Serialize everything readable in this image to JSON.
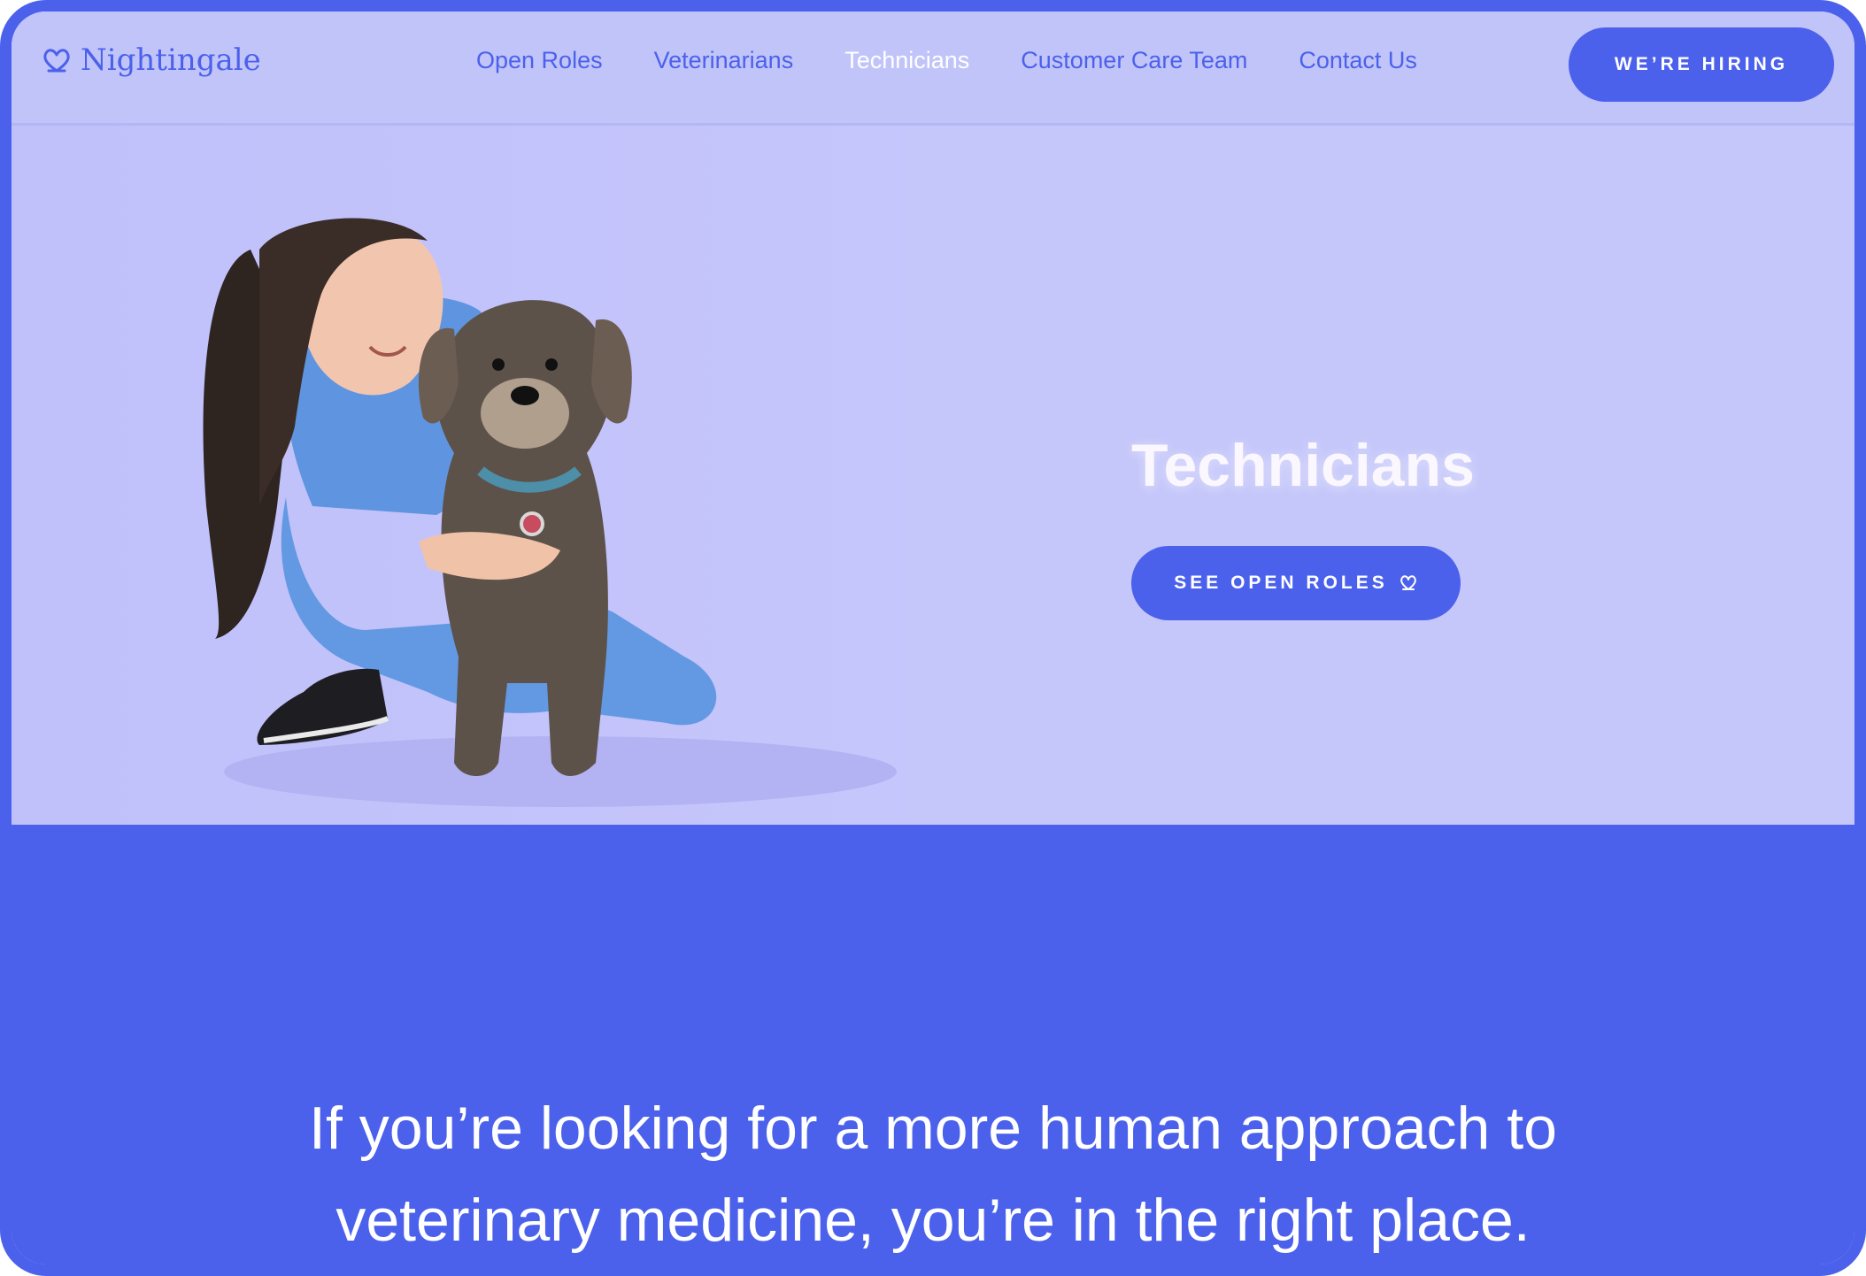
{
  "brand": {
    "name": "Nightingale",
    "color": "#4b61ec"
  },
  "nav": {
    "links": [
      {
        "label": "Open Roles",
        "active": false
      },
      {
        "label": "Veterinarians",
        "active": false
      },
      {
        "label": "Technicians",
        "active": true
      },
      {
        "label": "Customer Care Team",
        "active": false
      },
      {
        "label": "Contact Us",
        "active": false
      }
    ],
    "cta_label": "WE’RE HIRING"
  },
  "hero": {
    "title": "Technicians",
    "button_label": "SEE OPEN ROLES",
    "button_icon": "heart-outline-icon",
    "image": "technician-with-dog-photo"
  },
  "intro": {
    "line1": "If you’re looking for a more human approach to",
    "line2": "veterinary medicine, you’re in the right place."
  }
}
